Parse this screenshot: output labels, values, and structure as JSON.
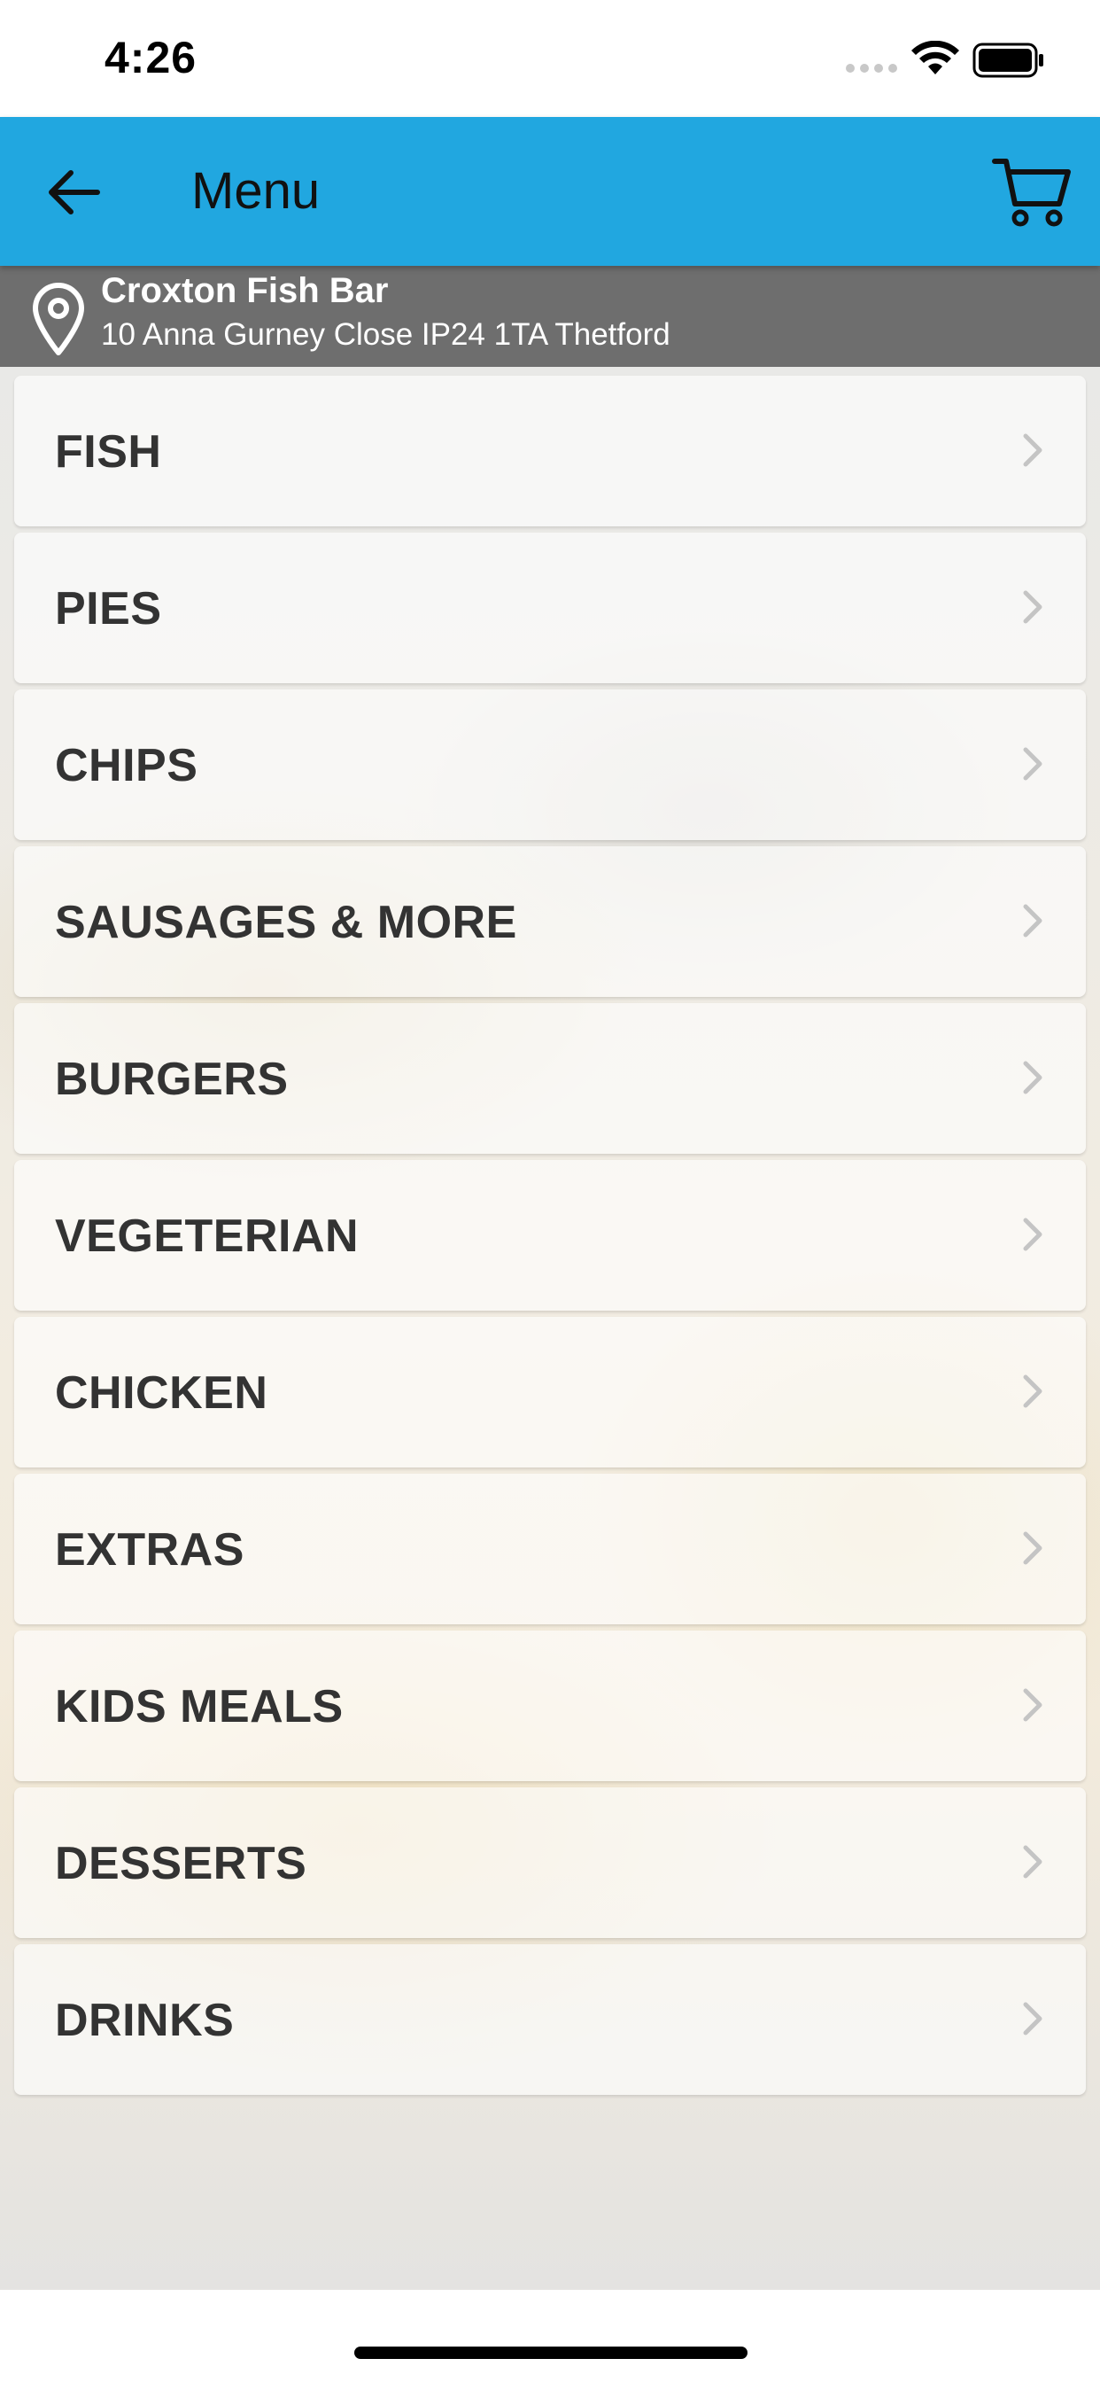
{
  "status_bar": {
    "time": "4:26"
  },
  "app_bar": {
    "title": "Menu",
    "back_icon": "arrow-left-icon",
    "cart_icon": "shopping-cart-icon",
    "background_color": "#21a7e0"
  },
  "location": {
    "icon": "map-pin-icon",
    "name": "Croxton Fish Bar",
    "address": "10 Anna Gurney Close IP24 1TA Thetford"
  },
  "categories": [
    {
      "label": "FISH"
    },
    {
      "label": "PIES"
    },
    {
      "label": "CHIPS"
    },
    {
      "label": "SAUSAGES & MORE"
    },
    {
      "label": "BURGERS"
    },
    {
      "label": "VEGETERIAN"
    },
    {
      "label": "CHICKEN"
    },
    {
      "label": "EXTRAS"
    },
    {
      "label": "KIDS MEALS"
    },
    {
      "label": "DESSERTS"
    },
    {
      "label": "DRINKS"
    }
  ]
}
